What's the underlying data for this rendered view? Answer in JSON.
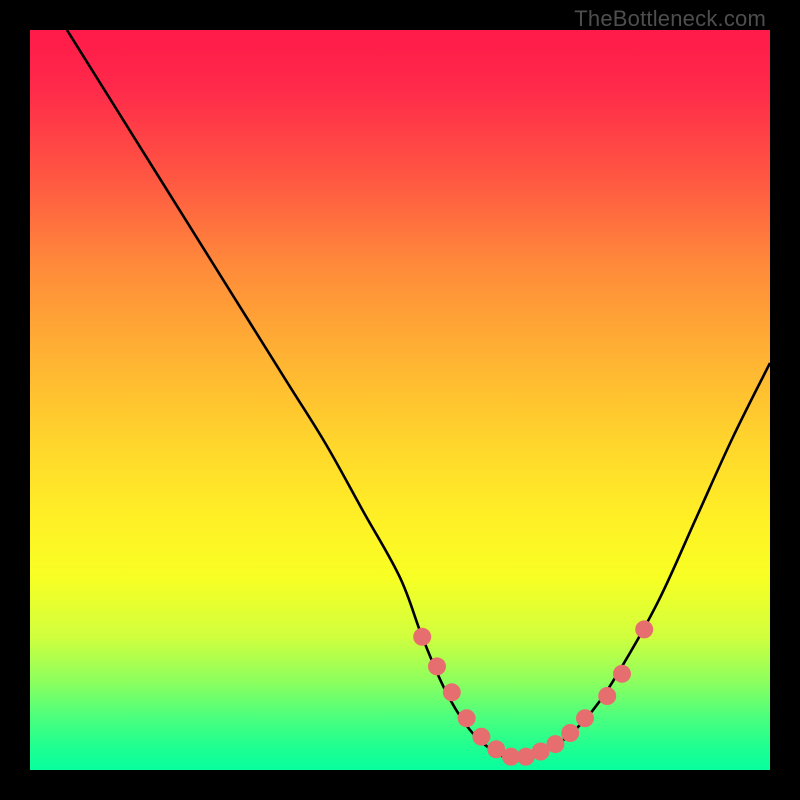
{
  "watermark": "TheBottleneck.com",
  "chart_data": {
    "type": "line",
    "title": "",
    "xlabel": "",
    "ylabel": "",
    "xlim": [
      0,
      100
    ],
    "ylim": [
      0,
      100
    ],
    "series": [
      {
        "name": "bottleneck-curve",
        "x": [
          5,
          10,
          15,
          20,
          25,
          30,
          35,
          40,
          45,
          50,
          53,
          56,
          59,
          62,
          65,
          68,
          72,
          76,
          80,
          85,
          90,
          95,
          100
        ],
        "y": [
          100,
          92,
          84,
          76,
          68,
          60,
          52,
          44,
          35,
          26,
          18,
          11,
          6,
          3,
          1.5,
          2,
          4,
          8,
          14,
          23,
          34,
          45,
          55
        ]
      }
    ],
    "markers": {
      "name": "highlight-dots",
      "color": "#e76e6e",
      "x": [
        53,
        55,
        57,
        59,
        61,
        63,
        65,
        67,
        69,
        71,
        73,
        75,
        78,
        80,
        83
      ],
      "y": [
        18,
        14,
        10.5,
        7,
        4.5,
        2.8,
        1.8,
        1.8,
        2.5,
        3.5,
        5,
        7,
        10,
        13,
        19
      ]
    },
    "colors": {
      "gradient_top": "#ff1a4a",
      "gradient_mid": "#ffd62c",
      "gradient_bottom": "#08ff9e",
      "curve": "#000000",
      "marker": "#e76e6e"
    }
  }
}
